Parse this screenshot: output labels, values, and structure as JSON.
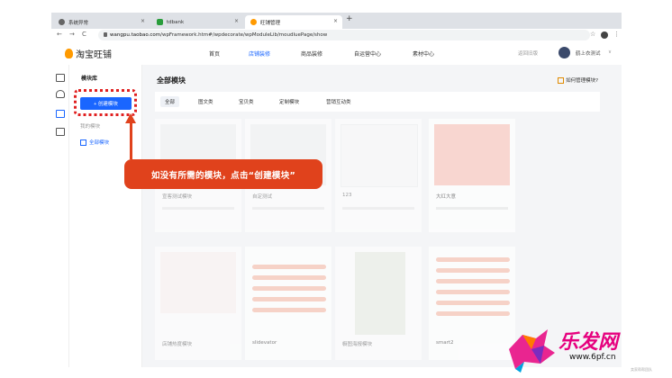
{
  "browser": {
    "tabs": [
      {
        "label": "系统异常",
        "icon": "globe-icon"
      },
      {
        "label": "tdbank",
        "icon": "tdbank-icon"
      },
      {
        "label": "旺铺管理",
        "icon": "taobao-icon"
      }
    ],
    "new_tab": "+",
    "close": "×",
    "back": "←",
    "forward": "→",
    "reload": "C",
    "url_host": "wangpu.taobao.com",
    "url_path": "/wpFramework.htm#/wpdecorate/wpModuleLib/moudluePage/show",
    "star": "☆",
    "menu": "⋮"
  },
  "topnav": {
    "brand": "淘宝旺铺",
    "items": [
      "首页",
      "店铺装修",
      "商品装修",
      "自运营中心",
      "素材中心"
    ],
    "active_index": 1,
    "back_old": "返回旧版",
    "username": "鹤上衣测试",
    "chevron": "∨"
  },
  "panel": {
    "title": "模块库",
    "create_label": "+ 创建模块",
    "my_modules": "我的模块",
    "all_modules": "全部模块"
  },
  "main": {
    "title": "全部模块",
    "help": "如何管理模块?",
    "filter_tabs": [
      "全部",
      "图文类",
      "宝贝类",
      "定制模块",
      "营销互动类"
    ],
    "cards": [
      {
        "name": "宣客测试模块"
      },
      {
        "name": "自定测试"
      },
      {
        "name": "123"
      },
      {
        "name": "大红大意"
      },
      {
        "name": "店铺热度模块"
      },
      {
        "name": "slidevator"
      },
      {
        "name": "橱图海报模块"
      },
      {
        "name": "smart2"
      }
    ]
  },
  "callout": {
    "text": "如没有所需的模块，点击“创建模块”"
  },
  "watermark": {
    "brand": "乐发网",
    "url": "www.6pf.cn",
    "small": "卖家帮帮团队"
  },
  "colors": {
    "accent": "#1a66ff",
    "callout": "#e0421c",
    "watermark": "#e6007e"
  }
}
